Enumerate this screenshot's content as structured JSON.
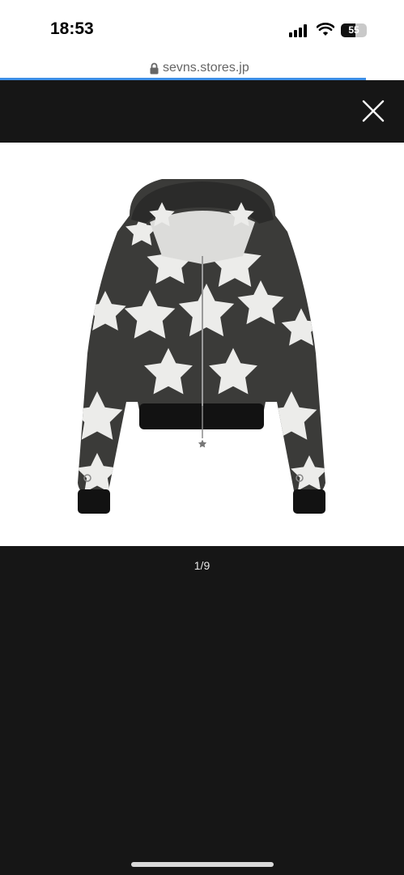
{
  "status_bar": {
    "time": "18:53",
    "battery_level": "55",
    "battery_fraction": 0.55,
    "icons": [
      "cellular-signal-icon",
      "wifi-icon",
      "battery-icon"
    ]
  },
  "browser": {
    "url": "sevns.stores.jp",
    "lock_icon": "lock-icon",
    "load_progress": 0.905,
    "accent_color": "#3d8ee6"
  },
  "viewer": {
    "close_icon": "close-icon",
    "pager_text": "1/9",
    "background_color": "#161616"
  },
  "product": {
    "image": "black hooded zip jacket with white star pattern"
  }
}
